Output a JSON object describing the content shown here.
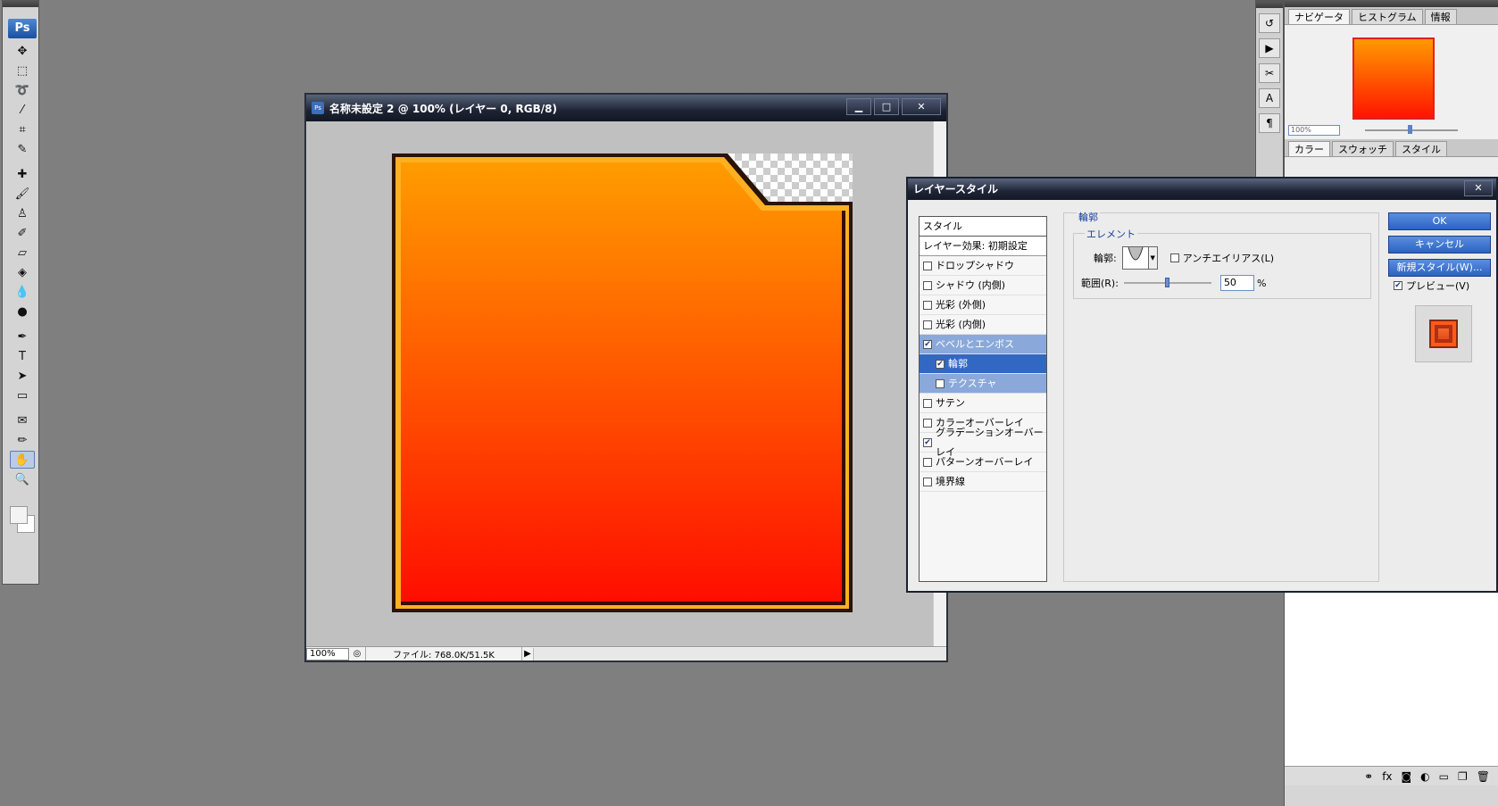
{
  "toolbox": {
    "logo": "Ps",
    "tools": [
      {
        "name": "move-tool-icon",
        "glyph": "✥"
      },
      {
        "name": "marquee-tool-icon",
        "glyph": "⬚"
      },
      {
        "name": "lasso-tool-icon",
        "glyph": "➰"
      },
      {
        "name": "magic-wand-tool-icon",
        "glyph": "⁄"
      },
      {
        "name": "crop-tool-icon",
        "glyph": "⌗"
      },
      {
        "name": "slice-tool-icon",
        "glyph": "✎"
      },
      {
        "name": "healing-brush-tool-icon",
        "glyph": "✚"
      },
      {
        "name": "brush-tool-icon",
        "glyph": "🖌"
      },
      {
        "name": "clone-stamp-tool-icon",
        "glyph": "♙"
      },
      {
        "name": "history-brush-tool-icon",
        "glyph": "✐"
      },
      {
        "name": "eraser-tool-icon",
        "glyph": "▱"
      },
      {
        "name": "paint-bucket-tool-icon",
        "glyph": "◈"
      },
      {
        "name": "blur-tool-icon",
        "glyph": "💧"
      },
      {
        "name": "dodge-tool-icon",
        "glyph": "●"
      },
      {
        "name": "pen-tool-icon",
        "glyph": "✒"
      },
      {
        "name": "type-tool-icon",
        "glyph": "T"
      },
      {
        "name": "path-selection-tool-icon",
        "glyph": "➤"
      },
      {
        "name": "shape-tool-icon",
        "glyph": "▭"
      },
      {
        "name": "notes-tool-icon",
        "glyph": "✉"
      },
      {
        "name": "eyedropper-tool-icon",
        "glyph": "✏"
      },
      {
        "name": "hand-tool-icon",
        "glyph": "✋"
      },
      {
        "name": "zoom-tool-icon",
        "glyph": "🔍"
      }
    ]
  },
  "document": {
    "title": "名称未設定 2 @ 100% (レイヤー 0, RGB/8)",
    "zoom": "100%",
    "file_info": "ファイル: 768.0K/51.5K",
    "colors": {
      "gradient_top": "#ff9c00",
      "gradient_bottom": "#ff0d00"
    }
  },
  "panels": {
    "navigator_tabs": [
      "ナビゲータ",
      "ヒストグラム",
      "情報"
    ],
    "navigator_zoom": "100%",
    "color_tabs": [
      "カラー",
      "スウォッチ",
      "スタイル"
    ]
  },
  "dialog": {
    "title": "レイヤースタイル",
    "list_header": "スタイル",
    "blending_options": "レイヤー効果: 初期設定",
    "items": [
      {
        "label": "ドロップシャドウ",
        "checked": false,
        "state": ""
      },
      {
        "label": "シャドウ (内側)",
        "checked": false,
        "state": ""
      },
      {
        "label": "光彩 (外側)",
        "checked": false,
        "state": ""
      },
      {
        "label": "光彩 (内側)",
        "checked": false,
        "state": ""
      },
      {
        "label": "ベベルとエンボス",
        "checked": true,
        "state": "hl-light"
      },
      {
        "label": "輪郭",
        "checked": true,
        "state": "hl",
        "sub": true
      },
      {
        "label": "テクスチャ",
        "checked": false,
        "state": "hl-light",
        "sub": true
      },
      {
        "label": "サテン",
        "checked": false,
        "state": ""
      },
      {
        "label": "カラーオーバーレイ",
        "checked": false,
        "state": ""
      },
      {
        "label": "グラデーションオーバーレイ",
        "checked": true,
        "state": ""
      },
      {
        "label": "パターンオーバーレイ",
        "checked": false,
        "state": ""
      },
      {
        "label": "境界線",
        "checked": false,
        "state": ""
      }
    ],
    "group_title": "輪郭",
    "sub_group_title": "エレメント",
    "contour_label": "輪郭:",
    "antialias_label": "アンチエイリアス(L)",
    "range_label": "範囲(R):",
    "range_value": "50",
    "range_unit": "%",
    "range_fraction": 0.5,
    "ok": "OK",
    "cancel": "キャンセル",
    "new_style": "新規スタイル(W)...",
    "preview_label": "プレビュー(V)",
    "close": "✕"
  }
}
